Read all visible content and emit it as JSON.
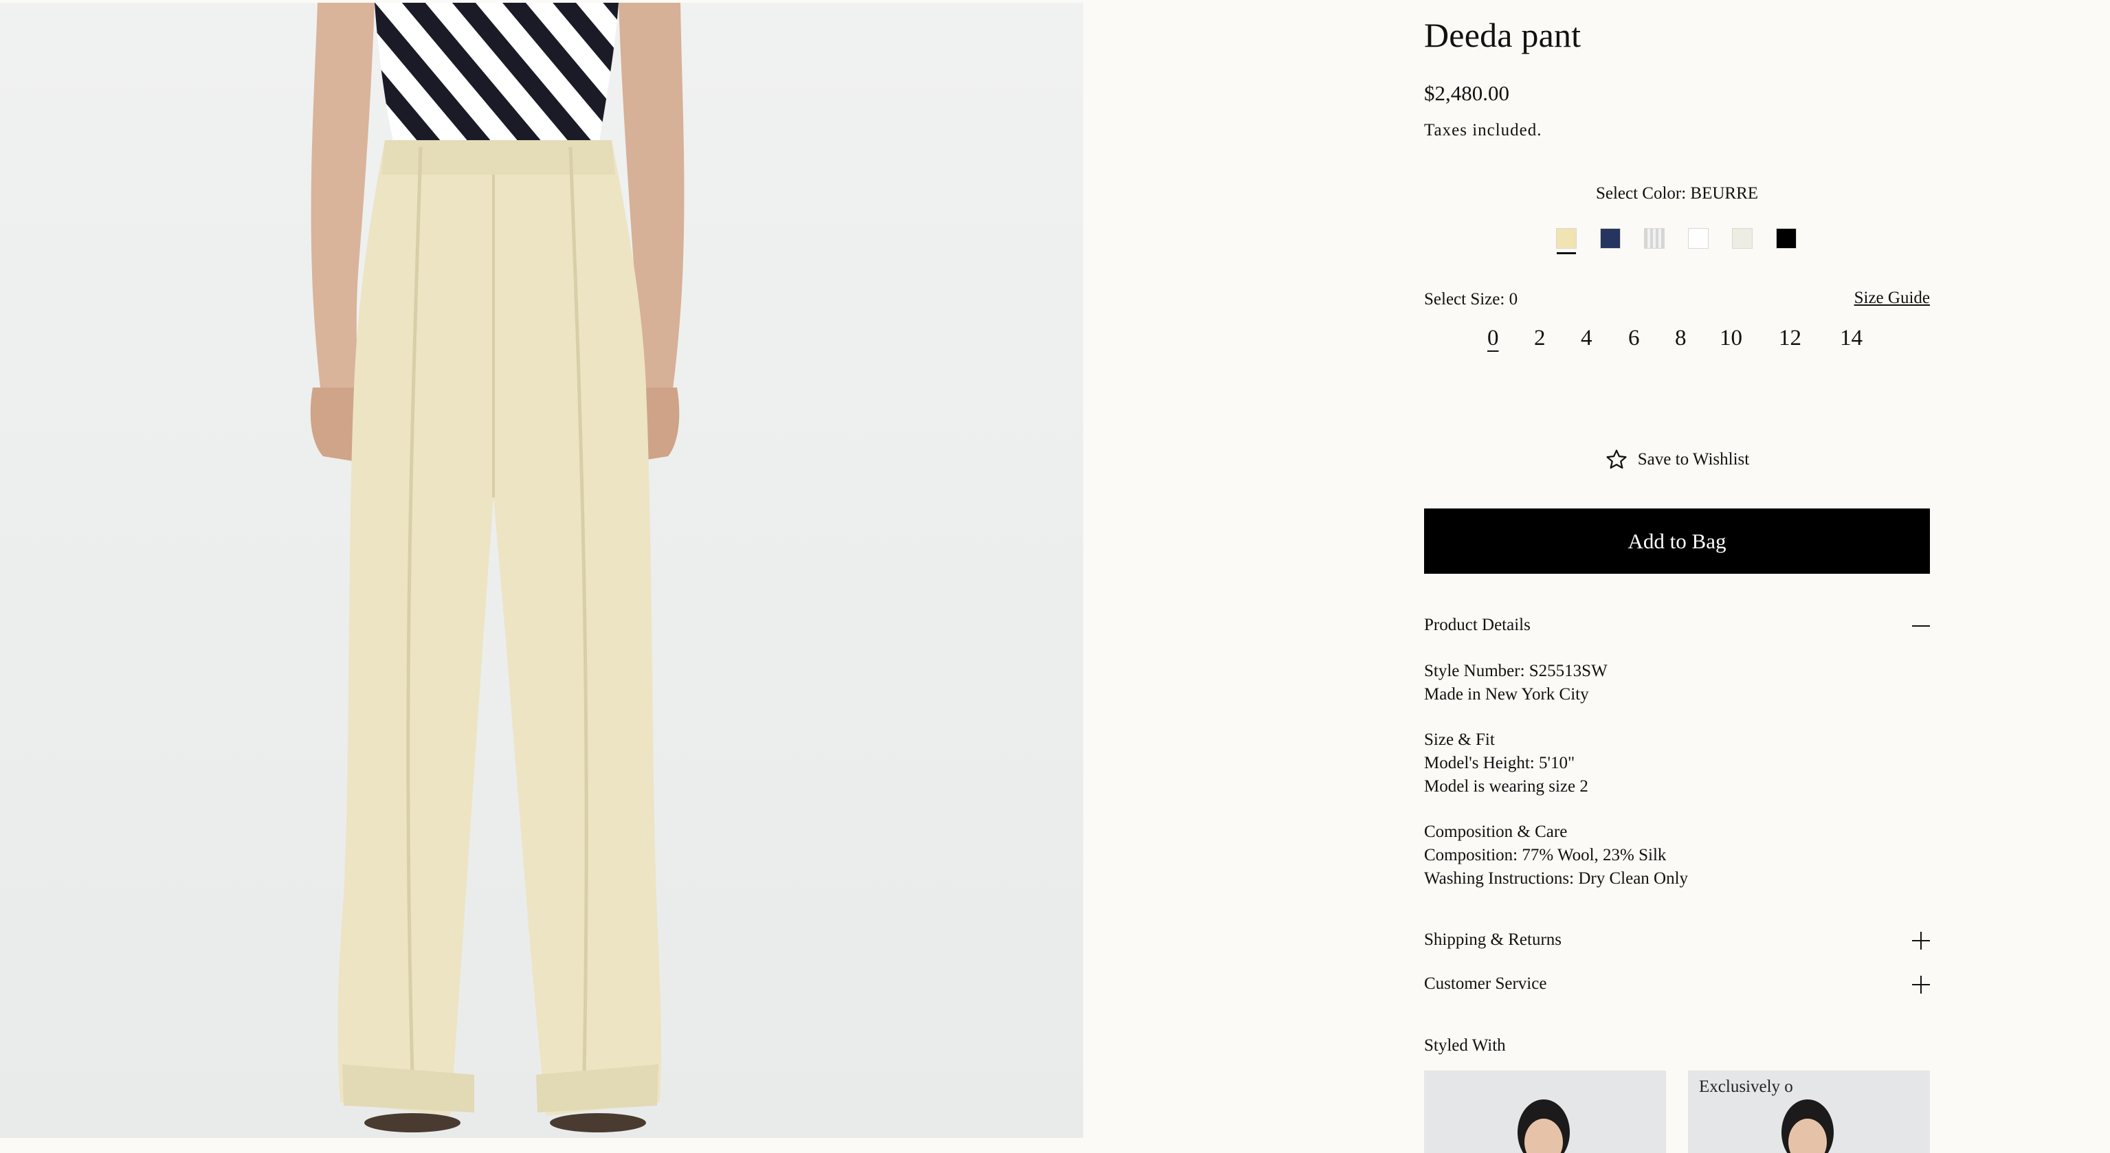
{
  "product": {
    "title": "Deeda pant",
    "price": "$2,480.00",
    "taxes_note": "Taxes included."
  },
  "color": {
    "label": "Select Color: BEURRE",
    "swatches": [
      {
        "name": "beurre",
        "hex": "#f1e4b2",
        "selected": true
      },
      {
        "name": "navy",
        "hex": "#26355f"
      },
      {
        "name": "grey-stripe",
        "hex": "#d6d6d6"
      },
      {
        "name": "white",
        "hex": "#ffffff"
      },
      {
        "name": "ivory",
        "hex": "#eeede4"
      },
      {
        "name": "black",
        "hex": "#000000"
      }
    ]
  },
  "size": {
    "label": "Select Size: 0",
    "guide_link": "Size Guide",
    "options": [
      "0",
      "2",
      "4",
      "6",
      "8",
      "10",
      "12",
      "14"
    ],
    "selected": "0"
  },
  "actions": {
    "wishlist": "Save to Wishlist",
    "add_to_bag": "Add to Bag"
  },
  "details": {
    "heading": "Product Details",
    "groups": [
      [
        "Style Number: S25513SW",
        "Made in New York City"
      ],
      [
        "Size & Fit",
        "Model's Height: 5'10\"",
        "Model is wearing size 2"
      ],
      [
        "Composition & Care",
        "Composition: 77% Wool, 23% Silk",
        "Washing Instructions: Dry Clean Only"
      ]
    ]
  },
  "accordions": {
    "shipping": "Shipping & Returns",
    "service": "Customer Service"
  },
  "styled_with": {
    "heading": "Styled With",
    "second_tag": "Exclusively o"
  },
  "colors": {
    "background": "#fbfaf6",
    "button": "#000000",
    "pant": "#ece4c3"
  }
}
